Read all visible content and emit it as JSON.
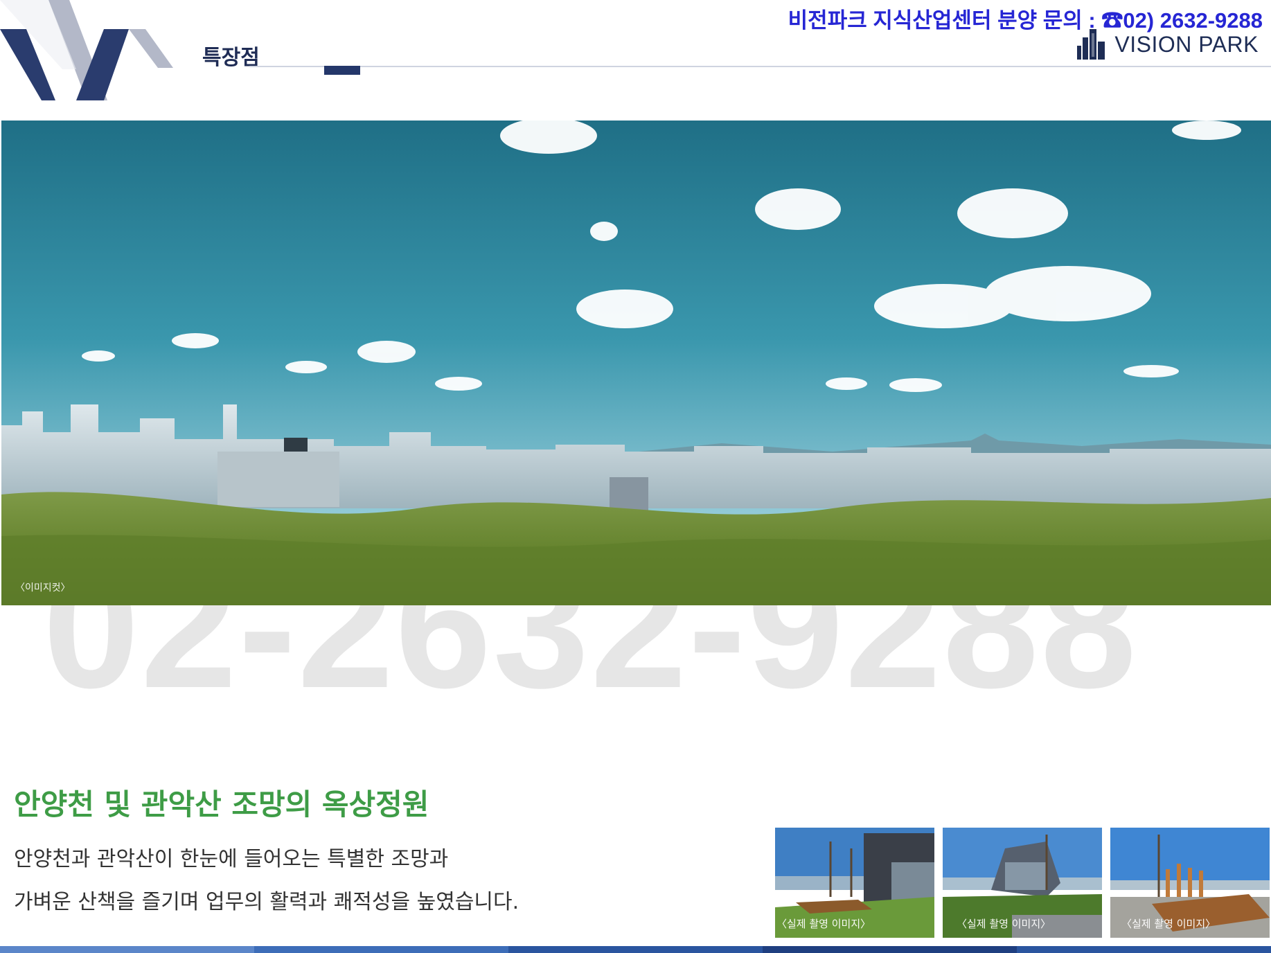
{
  "header": {
    "section_title": "특장점",
    "contact": "비전파크 지식산업센터 분양 문의 : ☎02) 2632-9288",
    "brand_name": "VISION PARK"
  },
  "hero": {
    "caption": "〈이미지컷〉"
  },
  "watermark": {
    "text": "02-2632-9288"
  },
  "feature": {
    "title": "안양천 및 관악산 조망의 옥상정원",
    "lines": [
      "안양천과 관악산이 한눈에 들어오는 특별한 조망과",
      "가벼운 산책을 즐기며 업무의 활력과 쾌적성을 높였습니다."
    ]
  },
  "thumbnails": [
    {
      "caption": "〈실제 촬영 이미지〉"
    },
    {
      "caption": "〈실제 촬영 이미지〉"
    },
    {
      "caption": "〈실제 촬영 이미지〉"
    }
  ],
  "colors": {
    "brand_navy": "#24376a",
    "contact_blue": "#2626d4",
    "feature_green": "#3e9c46",
    "watermark_gray": "#e6e6e6",
    "bottom_bar": [
      "#5b86c9",
      "#3d6db8",
      "#2a559f",
      "#1f3f80",
      "#2a559f"
    ]
  },
  "icons": {
    "logo": "vision-park-v-logo",
    "brand": "building-icon",
    "phone": "phone-icon"
  }
}
